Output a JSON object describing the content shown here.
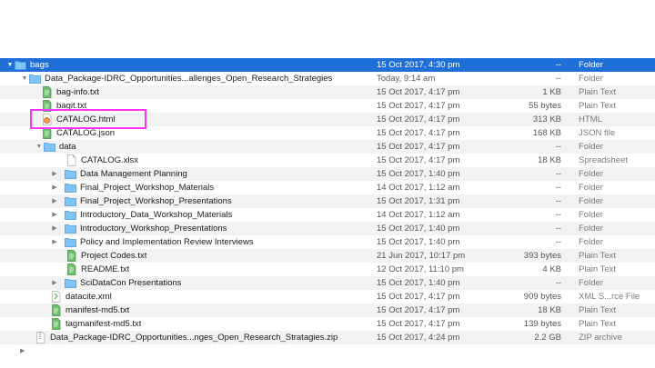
{
  "rows": [
    {
      "name": "bags",
      "date": "15 Oct 2017, 4:30 pm",
      "size": "--",
      "kind": "Folder",
      "icon": "folder-icon",
      "disclosure": "open"
    },
    {
      "name": "Data_Package-IDRC_Opportunities...allenges_Open_Research_Strategies",
      "date": "Today, 9:14 am",
      "size": "--",
      "kind": "Folder",
      "icon": "folder-icon",
      "disclosure": "open"
    },
    {
      "name": "bag-info.txt",
      "date": "15 Oct 2017, 4:17 pm",
      "size": "1 KB",
      "kind": "Plain Text",
      "icon": "text-file-icon",
      "disclosure": "none"
    },
    {
      "name": "bagit.txt",
      "date": "15 Oct 2017, 4:17 pm",
      "size": "55 bytes",
      "kind": "Plain Text",
      "icon": "text-file-icon",
      "disclosure": "none"
    },
    {
      "name": "CATALOG.html",
      "date": "15 Oct 2017, 4:17 pm",
      "size": "313 KB",
      "kind": "HTML",
      "icon": "html-file-icon",
      "disclosure": "none"
    },
    {
      "name": "CATALOG.json",
      "date": "15 Oct 2017, 4:17 pm",
      "size": "168 KB",
      "kind": "JSON file",
      "icon": "text-file-icon",
      "disclosure": "none"
    },
    {
      "name": "data",
      "date": "15 Oct 2017, 4:17 pm",
      "size": "--",
      "kind": "Folder",
      "icon": "folder-icon",
      "disclosure": "open"
    },
    {
      "name": "CATALOG.xlsx",
      "date": "15 Oct 2017, 4:17 pm",
      "size": "18 KB",
      "kind": "Spreadsheet",
      "icon": "blank-file-icon",
      "disclosure": "none"
    },
    {
      "name": "Data Management Planning",
      "date": "15 Oct 2017, 1:40 pm",
      "size": "--",
      "kind": "Folder",
      "icon": "folder-icon",
      "disclosure": "closed"
    },
    {
      "name": "Final_Project_Workshop_Materials",
      "date": "14 Oct 2017, 1:12 am",
      "size": "--",
      "kind": "Folder",
      "icon": "folder-icon",
      "disclosure": "closed"
    },
    {
      "name": "Final_Project_Workshop_Presentations",
      "date": "15 Oct 2017, 1:31 pm",
      "size": "--",
      "kind": "Folder",
      "icon": "folder-icon",
      "disclosure": "closed"
    },
    {
      "name": "Introductory_Data_Workshop_Materials",
      "date": "14 Oct 2017, 1:12 am",
      "size": "--",
      "kind": "Folder",
      "icon": "folder-icon",
      "disclosure": "closed"
    },
    {
      "name": "Introductory_Workshop_Presentations",
      "date": "15 Oct 2017, 1:40 pm",
      "size": "--",
      "kind": "Folder",
      "icon": "folder-icon",
      "disclosure": "closed"
    },
    {
      "name": "Policy and Implementation Review Interviews",
      "date": "15 Oct 2017, 1:40 pm",
      "size": "--",
      "kind": "Folder",
      "icon": "folder-icon",
      "disclosure": "closed"
    },
    {
      "name": "Project Codes.txt",
      "date": "21 Jun 2017, 10:17 pm",
      "size": "393 bytes",
      "kind": "Plain Text",
      "icon": "text-file-icon",
      "disclosure": "none"
    },
    {
      "name": "README.txt",
      "date": "12 Oct 2017, 11:10 pm",
      "size": "4 KB",
      "kind": "Plain Text",
      "icon": "text-file-icon",
      "disclosure": "none"
    },
    {
      "name": "SciDataCon Presentations",
      "date": "15 Oct 2017, 1:40 pm",
      "size": "--",
      "kind": "Folder",
      "icon": "folder-icon",
      "disclosure": "closed"
    },
    {
      "name": "datacite.xml",
      "date": "15 Oct 2017, 4:17 pm",
      "size": "909 bytes",
      "kind": "XML S...rce File",
      "icon": "xml-file-icon",
      "disclosure": "none"
    },
    {
      "name": "manifest-md5.txt",
      "date": "15 Oct 2017, 4:17 pm",
      "size": "18 KB",
      "kind": "Plain Text",
      "icon": "text-file-icon",
      "disclosure": "none"
    },
    {
      "name": "tagmanifest-md5.txt",
      "date": "15 Oct 2017, 4:17 pm",
      "size": "139 bytes",
      "kind": "Plain Text",
      "icon": "text-file-icon",
      "disclosure": "none"
    },
    {
      "name": "Data_Package-IDRC_Opportunities...nges_Open_Research_Stratagies.zip",
      "date": "15 Oct 2017, 4:24 pm",
      "size": "2.2 GB",
      "kind": "ZIP archive",
      "icon": "zip-file-icon",
      "disclosure": "none"
    }
  ],
  "colors": {
    "selection": "#1f6fd8",
    "highlight_box": "#ff33ff",
    "folder": "#5aa9ee",
    "text_file_green": "#5fb35f"
  }
}
